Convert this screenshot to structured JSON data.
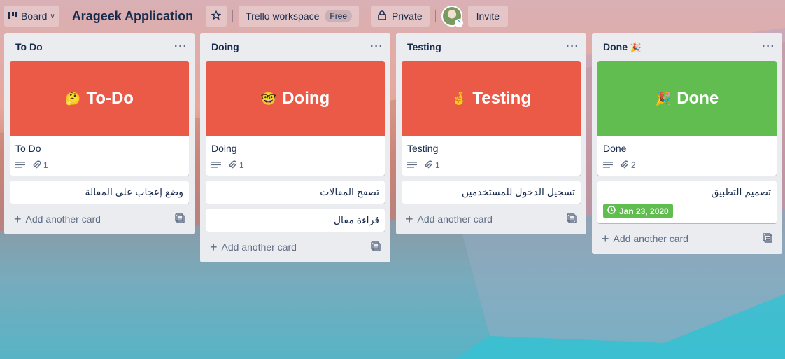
{
  "header": {
    "board_label": "Board",
    "board_title": "Arageek Application",
    "workspace_label": "Trello workspace",
    "free_badge": "Free",
    "visibility_label": "Private",
    "invite_label": "Invite"
  },
  "lists": [
    {
      "title": "To Do",
      "cover": {
        "emoji": "🤔",
        "text": "To-Do",
        "color": "#eb5a46"
      },
      "cover_card_title": "To Do",
      "attachments": "1",
      "cards": [
        {
          "text": "وضع إعجاب على المقالة"
        }
      ],
      "add_label": "Add another card"
    },
    {
      "title": "Doing",
      "cover": {
        "emoji": "🤓",
        "text": "Doing",
        "color": "#eb5a46"
      },
      "cover_card_title": "Doing",
      "attachments": "1",
      "cards": [
        {
          "text": "تصفح المقالات"
        },
        {
          "text": "قراءة مقال"
        }
      ],
      "add_label": "Add another card"
    },
    {
      "title": "Testing",
      "cover": {
        "emoji": "🤞",
        "text": "Testing",
        "color": "#eb5a46"
      },
      "cover_card_title": "Testing",
      "attachments": "1",
      "cards": [
        {
          "text": "تسجيل الدخول للمستخدمين"
        }
      ],
      "add_label": "Add another card"
    },
    {
      "title": "Done",
      "title_emoji": "🎉",
      "cover": {
        "emoji": "🎉",
        "text": "Done",
        "color": "#61bd4f"
      },
      "cover_card_title": "Done",
      "attachments": "2",
      "cards": [
        {
          "text": "تصميم التطبيق",
          "due": "Jan 23, 2020"
        }
      ],
      "add_label": "Add another card"
    }
  ],
  "colors": {
    "cover_red": "#eb5a46",
    "cover_green": "#61bd4f",
    "list_bg": "#ebecf0",
    "text": "#172b4d"
  },
  "icons": [
    "board-icon",
    "chevron-down-icon",
    "star-icon",
    "lock-icon",
    "ellipsis-icon",
    "description-icon",
    "attachment-icon",
    "plus-icon",
    "template-icon",
    "clock-icon"
  ]
}
